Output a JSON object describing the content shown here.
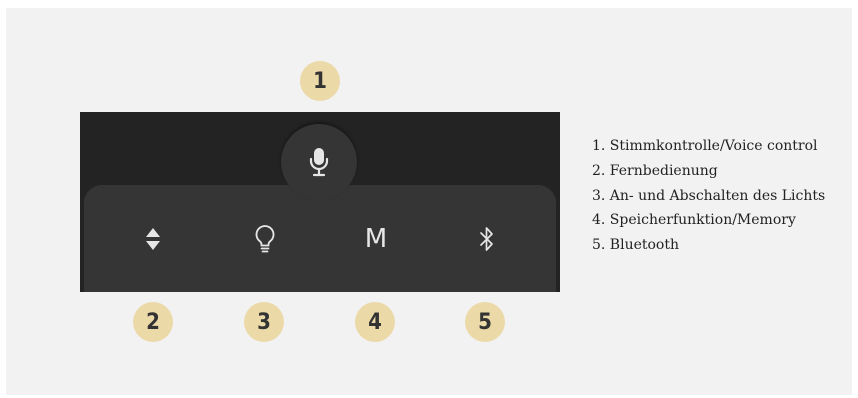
{
  "badges": [
    "1",
    "2",
    "3",
    "4",
    "5"
  ],
  "buttons": {
    "memory_label": "M"
  },
  "legend": [
    "1. Stimmkontrolle/Voice control",
    "2. Fernbedienung",
    "3. An- und Abschalten des Lichts",
    "4. Speicherfunktion/Memory",
    "5. Bluetooth"
  ],
  "colors": {
    "badge": "#ecd9a8",
    "panel": "#232323",
    "tray": "#353535",
    "icon": "#e6e6e6",
    "background": "#f2f2f2"
  },
  "icons": [
    "microphone-icon",
    "up-down-arrows-icon",
    "light-bulb-icon",
    "memory-m-icon",
    "bluetooth-icon"
  ]
}
